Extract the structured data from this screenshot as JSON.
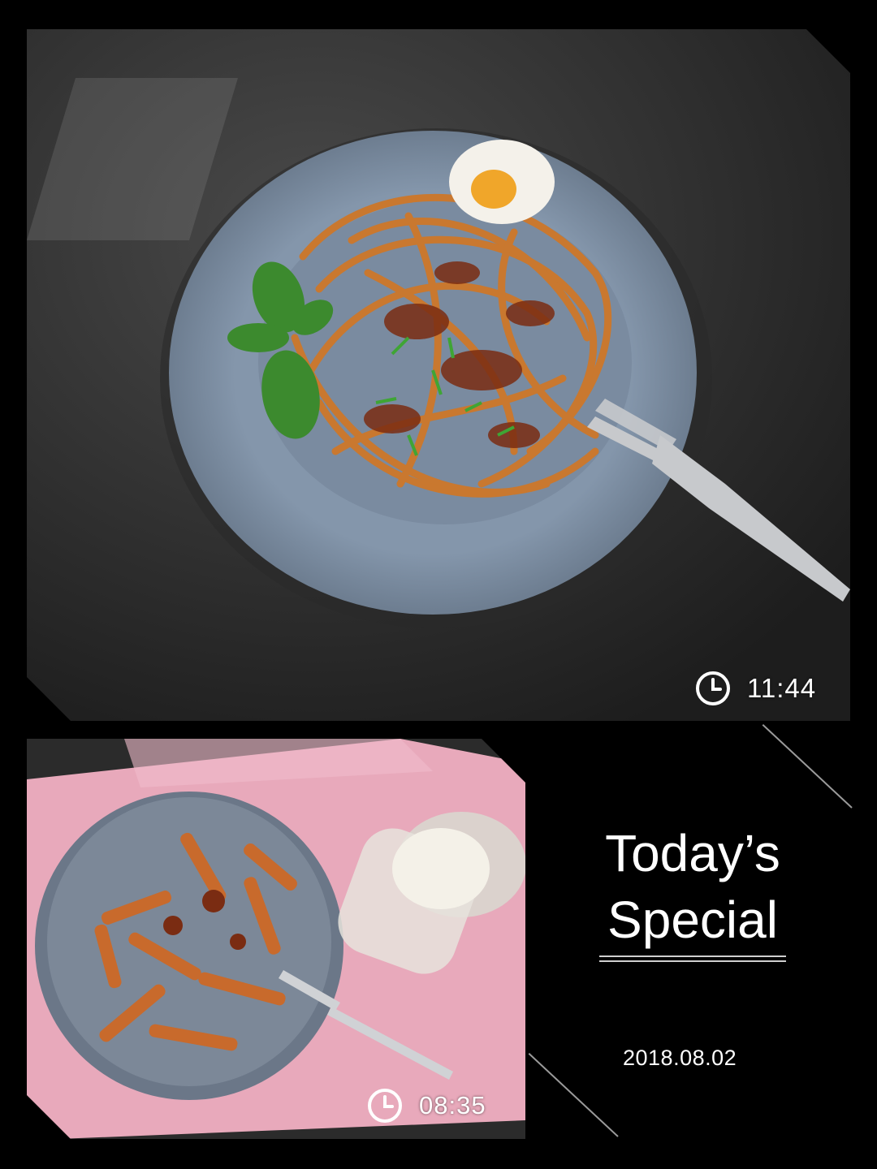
{
  "photos": {
    "top": {
      "time": "11:44"
    },
    "bottom": {
      "time": "08:35"
    }
  },
  "caption": {
    "line1": "Today’s",
    "line2": "Special"
  },
  "date": "2018.08.02",
  "colors": {
    "background": "#000000",
    "text": "#ffffff",
    "plate": "#7f8fa3",
    "cloth": "#e8a9bb"
  },
  "icons": [
    "clock-icon",
    "clock-icon"
  ]
}
